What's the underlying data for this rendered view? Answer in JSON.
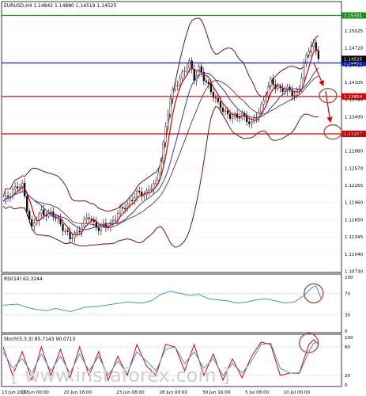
{
  "chart_data": [
    {
      "type": "candlestick",
      "title": "EURUSD,H4  1.14842 1.14880 1.14519 1.14525",
      "ylim": [
        1.1074,
        1.1552
      ],
      "yticks": [
        "1.15025",
        "1.14720",
        "1.14410",
        "1.14105",
        "1.13795",
        "1.13490",
        "1.13180",
        "1.12880",
        "1.12570",
        "1.12265",
        "1.11960",
        "1.11650",
        "1.11345",
        "1.11040",
        "1.10730"
      ],
      "yticks_values": [
        1.15025,
        1.1472,
        1.1441,
        1.14105,
        1.13795,
        1.1349,
        1.1318,
        1.1288,
        1.1257,
        1.12265,
        1.1196,
        1.1165,
        1.11345,
        1.1104,
        1.1073
      ],
      "xticks": [
        "13 Jun 2017",
        "16 Jun 00:00",
        "20 Jun 16:00",
        "23 Jun 08:00",
        "28 Jun 00:00",
        "30 Jun 16:00",
        "5 Jul 08:00",
        "10 Jul 00:00"
      ],
      "xticks_values": [
        0,
        12,
        30,
        52,
        70,
        88,
        106,
        122
      ],
      "x_count": 140,
      "levels": [
        {
          "value": 1.15301,
          "label": "1.15301",
          "color": "#1a8f1a"
        },
        {
          "value": 1.14452,
          "label": "1.14452",
          "color": "#0a1fd6"
        },
        {
          "value": 1.14525,
          "label": "1.14525",
          "color": "#000000"
        },
        {
          "value": 1.13854,
          "label": "1.13854",
          "color": "#e00000"
        },
        {
          "value": 1.13187,
          "label": "1.13187",
          "color": "#e00000"
        }
      ],
      "close_key": [
        [
          0,
          1.1195
        ],
        [
          4,
          1.122
        ],
        [
          8,
          1.1225
        ],
        [
          12,
          1.115
        ],
        [
          16,
          1.118
        ],
        [
          20,
          1.1175
        ],
        [
          24,
          1.116
        ],
        [
          28,
          1.113
        ],
        [
          32,
          1.115
        ],
        [
          36,
          1.117
        ],
        [
          40,
          1.115
        ],
        [
          44,
          1.1155
        ],
        [
          48,
          1.1175
        ],
        [
          52,
          1.1195
        ],
        [
          56,
          1.121
        ],
        [
          60,
          1.1215
        ],
        [
          64,
          1.123
        ],
        [
          66,
          1.1275
        ],
        [
          68,
          1.133
        ],
        [
          70,
          1.138
        ],
        [
          72,
          1.1405
        ],
        [
          74,
          1.142
        ],
        [
          76,
          1.143
        ],
        [
          78,
          1.1445
        ],
        [
          80,
          1.142
        ],
        [
          82,
          1.1435
        ],
        [
          84,
          1.1415
        ],
        [
          86,
          1.1405
        ],
        [
          88,
          1.139
        ],
        [
          90,
          1.137
        ],
        [
          92,
          1.136
        ],
        [
          94,
          1.1355
        ],
        [
          96,
          1.135
        ],
        [
          98,
          1.1345
        ],
        [
          100,
          1.1355
        ],
        [
          102,
          1.1345
        ],
        [
          104,
          1.1335
        ],
        [
          106,
          1.135
        ],
        [
          108,
          1.137
        ],
        [
          110,
          1.139
        ],
        [
          112,
          1.141
        ],
        [
          114,
          1.1405
        ],
        [
          116,
          1.14
        ],
        [
          118,
          1.1395
        ],
        [
          120,
          1.1395
        ],
        [
          122,
          1.139
        ],
        [
          124,
          1.14
        ],
        [
          126,
          1.144
        ],
        [
          128,
          1.147
        ],
        [
          129,
          1.148
        ],
        [
          130,
          1.148
        ],
        [
          131,
          1.1465
        ],
        [
          132,
          1.14525
        ]
      ],
      "indicators": [
        "moving-average-red",
        "moving-average-blue",
        "bollinger-bands"
      ],
      "annotations": [
        {
          "kind": "arrow",
          "color": "#e00000",
          "from": [
            130,
            1.1446
          ],
          "to": [
            134,
            1.1405
          ]
        },
        {
          "kind": "arrow",
          "color": "#e00000",
          "from": [
            135,
            1.1395
          ],
          "to": [
            137,
            1.134
          ]
        },
        {
          "kind": "circle",
          "color": "#a65a3a",
          "at": [
            136,
            1.1387
          ]
        },
        {
          "kind": "circle",
          "color": "#a65a3a",
          "at": [
            138,
            1.1322
          ]
        }
      ]
    },
    {
      "type": "line",
      "title": "RSI(14) 62.3244",
      "ylim": [
        0,
        100
      ],
      "yticks": [
        "100",
        "70",
        "30",
        "0"
      ],
      "yticks_values": [
        100,
        70,
        30,
        0
      ],
      "levels": [
        70,
        30
      ],
      "series": [
        {
          "color": "#4a90e2",
          "points": [
            [
              0,
              48
            ],
            [
              6,
              50
            ],
            [
              10,
              44
            ],
            [
              14,
              40
            ],
            [
              18,
              38
            ],
            [
              22,
              42
            ],
            [
              28,
              36
            ],
            [
              34,
              44
            ],
            [
              40,
              46
            ],
            [
              46,
              50
            ],
            [
              52,
              54
            ],
            [
              58,
              52
            ],
            [
              62,
              56
            ],
            [
              66,
              68
            ],
            [
              70,
              74
            ],
            [
              74,
              70
            ],
            [
              78,
              66
            ],
            [
              82,
              68
            ],
            [
              86,
              60
            ],
            [
              90,
              58
            ],
            [
              94,
              56
            ],
            [
              98,
              52
            ],
            [
              102,
              54
            ],
            [
              106,
              58
            ],
            [
              110,
              60
            ],
            [
              114,
              56
            ],
            [
              118,
              52
            ],
            [
              122,
              54
            ],
            [
              126,
              66
            ],
            [
              129,
              80
            ],
            [
              131,
              84
            ],
            [
              133,
              62
            ]
          ]
        }
      ],
      "annotations": [
        {
          "kind": "circle",
          "color": "#a65a3a",
          "at": [
            130,
            70
          ]
        }
      ]
    },
    {
      "type": "line",
      "title": "Stoch(5,3,3) 85.7143 90.0713",
      "ylim": [
        0,
        100
      ],
      "yticks": [
        "100",
        "80",
        "20",
        "0"
      ],
      "yticks_values": [
        100,
        80,
        20,
        0
      ],
      "levels": [
        80,
        20
      ],
      "series": [
        {
          "color": "#e00000",
          "points": [
            [
              0,
              80
            ],
            [
              4,
              20
            ],
            [
              8,
              70
            ],
            [
              12,
              10
            ],
            [
              16,
              80
            ],
            [
              20,
              20
            ],
            [
              24,
              75
            ],
            [
              28,
              15
            ],
            [
              32,
              80
            ],
            [
              36,
              20
            ],
            [
              40,
              70
            ],
            [
              44,
              10
            ],
            [
              48,
              60
            ],
            [
              52,
              20
            ],
            [
              56,
              85
            ],
            [
              60,
              40
            ],
            [
              64,
              20
            ],
            [
              68,
              85
            ],
            [
              72,
              80
            ],
            [
              76,
              30
            ],
            [
              80,
              85
            ],
            [
              84,
              20
            ],
            [
              88,
              65
            ],
            [
              92,
              10
            ],
            [
              96,
              55
            ],
            [
              100,
              15
            ],
            [
              104,
              60
            ],
            [
              108,
              90
            ],
            [
              112,
              85
            ],
            [
              116,
              20
            ],
            [
              120,
              25
            ],
            [
              124,
              25
            ],
            [
              128,
              85
            ],
            [
              130,
              95
            ],
            [
              132,
              86
            ]
          ]
        },
        {
          "color": "#4a90e2",
          "points": [
            [
              0,
              70
            ],
            [
              4,
              35
            ],
            [
              8,
              55
            ],
            [
              12,
              25
            ],
            [
              16,
              65
            ],
            [
              20,
              30
            ],
            [
              24,
              60
            ],
            [
              28,
              25
            ],
            [
              32,
              65
            ],
            [
              36,
              30
            ],
            [
              40,
              60
            ],
            [
              44,
              20
            ],
            [
              48,
              50
            ],
            [
              52,
              25
            ],
            [
              56,
              70
            ],
            [
              60,
              50
            ],
            [
              64,
              30
            ],
            [
              68,
              75
            ],
            [
              72,
              80
            ],
            [
              76,
              45
            ],
            [
              80,
              70
            ],
            [
              84,
              35
            ],
            [
              88,
              55
            ],
            [
              92,
              20
            ],
            [
              96,
              45
            ],
            [
              100,
              25
            ],
            [
              104,
              50
            ],
            [
              108,
              85
            ],
            [
              112,
              88
            ],
            [
              116,
              35
            ],
            [
              120,
              25
            ],
            [
              124,
              24
            ],
            [
              128,
              70
            ],
            [
              130,
              88
            ],
            [
              132,
              90
            ]
          ]
        }
      ],
      "annotations": [
        {
          "kind": "circle",
          "color": "#a65a3a",
          "at": [
            128,
            88
          ]
        }
      ]
    }
  ],
  "watermark": "[ www.instaforex.com ]"
}
